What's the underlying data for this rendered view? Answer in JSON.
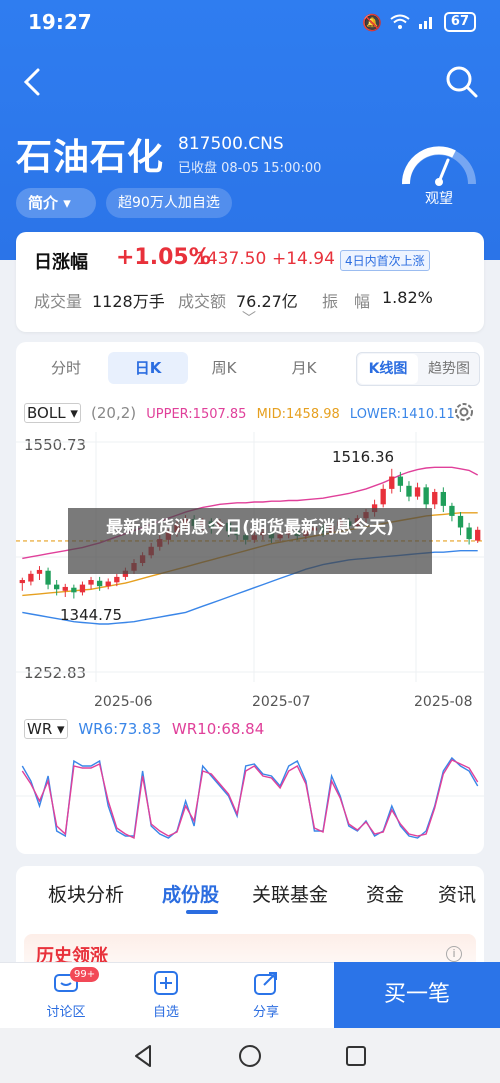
{
  "status_bar": {
    "time": "19:27",
    "battery": "67"
  },
  "header": {
    "stock_name": "石油石化",
    "stock_code": "817500.CNS",
    "status_text": "已收盘  08-05 15:00:00",
    "intro_label": "简介 ▾",
    "follow_label": "超90万人加自选",
    "sentiment_label": "观望"
  },
  "quote": {
    "label": "日涨幅",
    "change_pct": "+1.05%",
    "price": "1437.50",
    "change": "+14.94",
    "tag": "4日内首次上涨",
    "volume_label": "成交量",
    "volume_value": "1128万手",
    "turnover_label": "成交额",
    "turnover_value": "76.27亿",
    "amplitude_label": "振　幅",
    "amplitude_value": "1.82%"
  },
  "chart_tabs": [
    "分时",
    "日K",
    "周K",
    "月K"
  ],
  "chart_tabs_active": "日K",
  "chart_modes": [
    "K线图",
    "趋势图"
  ],
  "chart_mode_active": "K线图",
  "indicators": {
    "name": "BOLL ▾",
    "param": "(20,2)",
    "upper": "UPPER:1507.85",
    "mid": "MID:1458.98",
    "lower": "LOWER:1410.11"
  },
  "wr_indicators": {
    "name": "WR ▾",
    "wr6": "WR6:73.83",
    "wr10": "WR10:68.84"
  },
  "chart_data": {
    "type": "candlestick",
    "ylim": [
      1252.83,
      1550.73
    ],
    "y_tick_labels": [
      "1550.73",
      "1252.83"
    ],
    "x_tick_labels": [
      "2025-06",
      "2025-07",
      "2025-08"
    ],
    "high_label": "1516.36",
    "low_label": "1344.75",
    "candles": [
      [
        1368,
        1372,
        1358,
        1375
      ],
      [
        1370,
        1380,
        1365,
        1384
      ],
      [
        1380,
        1385,
        1372,
        1390
      ],
      [
        1384,
        1366,
        1360,
        1388
      ],
      [
        1366,
        1360,
        1352,
        1372
      ],
      [
        1358,
        1363,
        1350,
        1367
      ],
      [
        1362,
        1356,
        1348,
        1366
      ],
      [
        1356,
        1366,
        1352,
        1370
      ],
      [
        1366,
        1372,
        1360,
        1376
      ],
      [
        1371,
        1364,
        1358,
        1376
      ],
      [
        1364,
        1370,
        1360,
        1374
      ],
      [
        1369,
        1376,
        1364,
        1380
      ],
      [
        1376,
        1384,
        1372,
        1388
      ],
      [
        1384,
        1394,
        1380,
        1399
      ],
      [
        1394,
        1404,
        1390,
        1408
      ],
      [
        1404,
        1415,
        1400,
        1420
      ],
      [
        1415,
        1425,
        1410,
        1430
      ],
      [
        1424,
        1434,
        1418,
        1438
      ],
      [
        1434,
        1444,
        1428,
        1448
      ],
      [
        1443,
        1451,
        1438,
        1456
      ],
      [
        1451,
        1442,
        1436,
        1456
      ],
      [
        1442,
        1448,
        1436,
        1452
      ],
      [
        1448,
        1440,
        1432,
        1452
      ],
      [
        1440,
        1447,
        1434,
        1451
      ],
      [
        1446,
        1435,
        1428,
        1450
      ],
      [
        1436,
        1430,
        1424,
        1440
      ],
      [
        1430,
        1424,
        1418,
        1434
      ],
      [
        1424,
        1430,
        1420,
        1436
      ],
      [
        1430,
        1434,
        1424,
        1438
      ],
      [
        1434,
        1426,
        1420,
        1438
      ],
      [
        1426,
        1431,
        1422,
        1436
      ],
      [
        1431,
        1436,
        1426,
        1440
      ],
      [
        1436,
        1429,
        1424,
        1440
      ],
      [
        1429,
        1436,
        1425,
        1440
      ],
      [
        1436,
        1440,
        1430,
        1444
      ],
      [
        1440,
        1434,
        1428,
        1444
      ],
      [
        1434,
        1442,
        1430,
        1446
      ],
      [
        1442,
        1448,
        1436,
        1452
      ],
      [
        1448,
        1442,
        1438,
        1452
      ],
      [
        1442,
        1452,
        1438,
        1456
      ],
      [
        1452,
        1460,
        1446,
        1464
      ],
      [
        1460,
        1470,
        1454,
        1476
      ],
      [
        1470,
        1490,
        1466,
        1496
      ],
      [
        1490,
        1506,
        1484,
        1516
      ],
      [
        1506,
        1494,
        1486,
        1512
      ],
      [
        1494,
        1480,
        1474,
        1500
      ],
      [
        1480,
        1492,
        1476,
        1498
      ],
      [
        1492,
        1470,
        1464,
        1496
      ],
      [
        1470,
        1486,
        1464,
        1490
      ],
      [
        1486,
        1468,
        1460,
        1492
      ],
      [
        1468,
        1455,
        1448,
        1472
      ],
      [
        1455,
        1440,
        1430,
        1460
      ],
      [
        1440,
        1425,
        1418,
        1446
      ],
      [
        1423,
        1437,
        1420,
        1441
      ]
    ],
    "series": [
      {
        "name": "UPPER",
        "color": "#e0409a",
        "values": [
          1400,
          1402,
          1404,
          1406,
          1408,
          1410,
          1412,
          1414,
          1417,
          1420,
          1424,
          1428,
          1432,
          1436,
          1440,
          1444,
          1448,
          1452,
          1456,
          1460,
          1463,
          1466,
          1468,
          1470,
          1471,
          1472,
          1472,
          1473,
          1473,
          1474,
          1474,
          1475,
          1475,
          1476,
          1477,
          1478,
          1480,
          1482,
          1484,
          1487,
          1490,
          1494,
          1498,
          1503,
          1508,
          1512,
          1515,
          1517,
          1518,
          1518,
          1518,
          1516,
          1514,
          1508
        ]
      },
      {
        "name": "MID",
        "color": "#e6a020",
        "values": [
          1352,
          1353,
          1354,
          1355,
          1356,
          1357,
          1358,
          1359,
          1360,
          1362,
          1364,
          1366,
          1368,
          1371,
          1374,
          1377,
          1380,
          1383,
          1386,
          1389,
          1392,
          1395,
          1398,
          1401,
          1404,
          1407,
          1410,
          1413,
          1416,
          1419,
          1421,
          1423,
          1425,
          1427,
          1429,
          1431,
          1433,
          1435,
          1437,
          1439,
          1441,
          1443,
          1445,
          1447,
          1449,
          1451,
          1453,
          1455,
          1456,
          1457,
          1458,
          1459,
          1459,
          1459
        ]
      },
      {
        "name": "LOWER",
        "color": "#3a86e8",
        "values": [
          1330,
          1328,
          1326,
          1324,
          1322,
          1320,
          1318,
          1317,
          1316,
          1315,
          1315,
          1316,
          1317,
          1318,
          1320,
          1322,
          1324,
          1326,
          1328,
          1330,
          1334,
          1338,
          1342,
          1346,
          1350,
          1354,
          1358,
          1362,
          1366,
          1370,
          1374,
          1378,
          1382,
          1386,
          1389,
          1392,
          1394,
          1396,
          1398,
          1399,
          1400,
          1401,
          1402,
          1403,
          1404,
          1405,
          1406,
          1407,
          1408,
          1408,
          1409,
          1410,
          1410,
          1410
        ]
      }
    ],
    "reference_price": 1422.56,
    "wr": {
      "ylim": [
        0,
        100
      ],
      "wr6": [
        20,
        35,
        60,
        30,
        85,
        90,
        15,
        20,
        20,
        15,
        60,
        85,
        90,
        90,
        25,
        80,
        88,
        92,
        85,
        55,
        80,
        20,
        30,
        40,
        50,
        70,
        20,
        18,
        28,
        30,
        40,
        20,
        15,
        35,
        85,
        85,
        30,
        50,
        80,
        85,
        75,
        90,
        85,
        60,
        80,
        90,
        92,
        85,
        60,
        25,
        12,
        20,
        25,
        40
      ],
      "wr10": [
        25,
        38,
        55,
        35,
        80,
        88,
        20,
        22,
        22,
        18,
        55,
        82,
        88,
        92,
        30,
        78,
        85,
        90,
        86,
        60,
        75,
        25,
        28,
        38,
        48,
        68,
        25,
        20,
        30,
        32,
        42,
        25,
        20,
        38,
        82,
        86,
        35,
        52,
        78,
        84,
        76,
        88,
        86,
        64,
        78,
        88,
        90,
        88,
        62,
        28,
        14,
        18,
        22,
        36
      ]
    }
  },
  "info_tabs": [
    "板块分析",
    "成份股",
    "关联基金",
    "资金",
    "资讯"
  ],
  "info_tab_active": "成份股",
  "history_title": "历史领涨",
  "overlay_text": "最新期货消息今日(期货最新消息今天)",
  "bottom_bar": {
    "discussion_label": "讨论区",
    "discussion_badge": "99+",
    "watchlist_label": "自选",
    "share_label": "分享",
    "buy_label": "买一笔"
  }
}
